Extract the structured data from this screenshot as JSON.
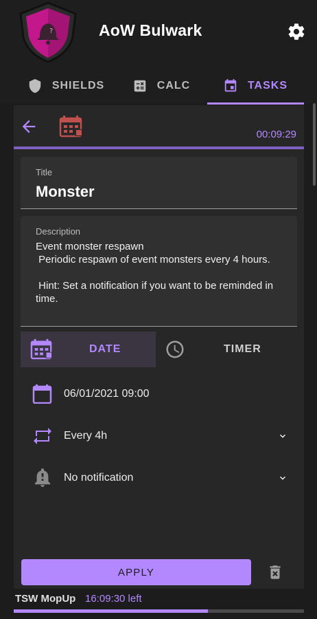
{
  "app": {
    "title": "AoW Bulwark"
  },
  "tabs": [
    {
      "label": "SHIELDS",
      "icon": "shield-icon",
      "active": false
    },
    {
      "label": "CALC",
      "icon": "calculator-icon",
      "active": false
    },
    {
      "label": "TASKS",
      "icon": "calendar-icon",
      "active": true
    }
  ],
  "task": {
    "timer": "00:09:29",
    "title_label": "Title",
    "title_value": "Monster",
    "description_label": "Description",
    "description_value": "Event monster respawn\n Periodic respawn of event monsters every 4 hours.\n\n Hint: Set a notification if you want to be reminded in time."
  },
  "mode": {
    "date_label": "DATE",
    "timer_label": "TIMER",
    "selected": "DATE"
  },
  "schedule": {
    "datetime": "06/01/2021 09:00",
    "repeat": "Every 4h",
    "notification": "No notification"
  },
  "actions": {
    "apply_label": "APPLY"
  },
  "status": {
    "task_name": "TSW MopUp",
    "time_left": "16:09:30 left",
    "progress": 0.67
  },
  "colors": {
    "accent": "#b388ff",
    "danger": "#c0504d",
    "background": "#1c1c1c",
    "card": "#272727"
  }
}
